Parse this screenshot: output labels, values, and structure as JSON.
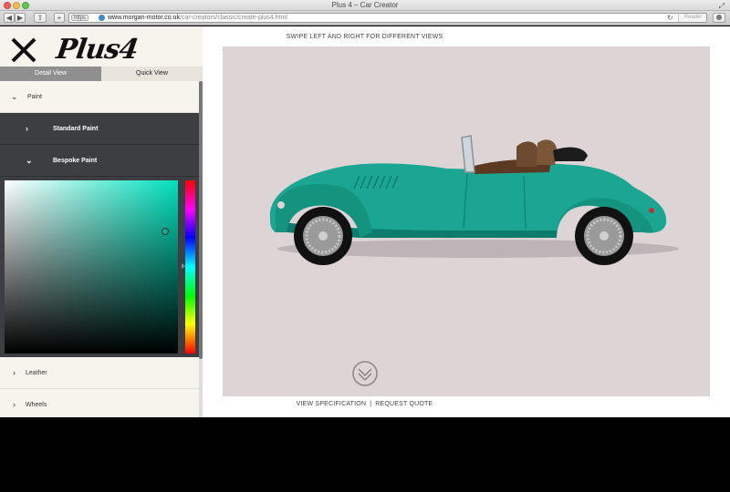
{
  "window": {
    "title": "Plus 4 – Car Creator"
  },
  "browser": {
    "back_label": "◀",
    "forward_label": "▶",
    "https_label": "https",
    "url_host": "www.morgan-motor.co.uk",
    "url_path": "/car-creators/classic/create-plus4.html",
    "reader_label": "Reader"
  },
  "sidebar": {
    "logo_text": "Plus4",
    "tabs": [
      {
        "label": "Detail View",
        "active": true
      },
      {
        "label": "Quick View",
        "active": false
      }
    ],
    "sections": {
      "paint": "Paint",
      "standard_paint": "Standard Paint",
      "bespoke_paint": "Bespoke Paint",
      "leather": "Leather",
      "wheels": "Wheels"
    },
    "color_picker": {
      "selected_color": "#1aa692",
      "hue_color": "#00e0bc"
    }
  },
  "main": {
    "swipe_hint": "SWIPE LEFT AND RIGHT FOR DIFFERENT VIEWS",
    "view_specification": "VIEW SPECIFICATION",
    "separator": "|",
    "request_quote": "REQUEST QUOTE",
    "stage_background": "#ddd4d6",
    "car_body_color": "#1aa692",
    "car_shade_color": "#0e7c6c"
  }
}
